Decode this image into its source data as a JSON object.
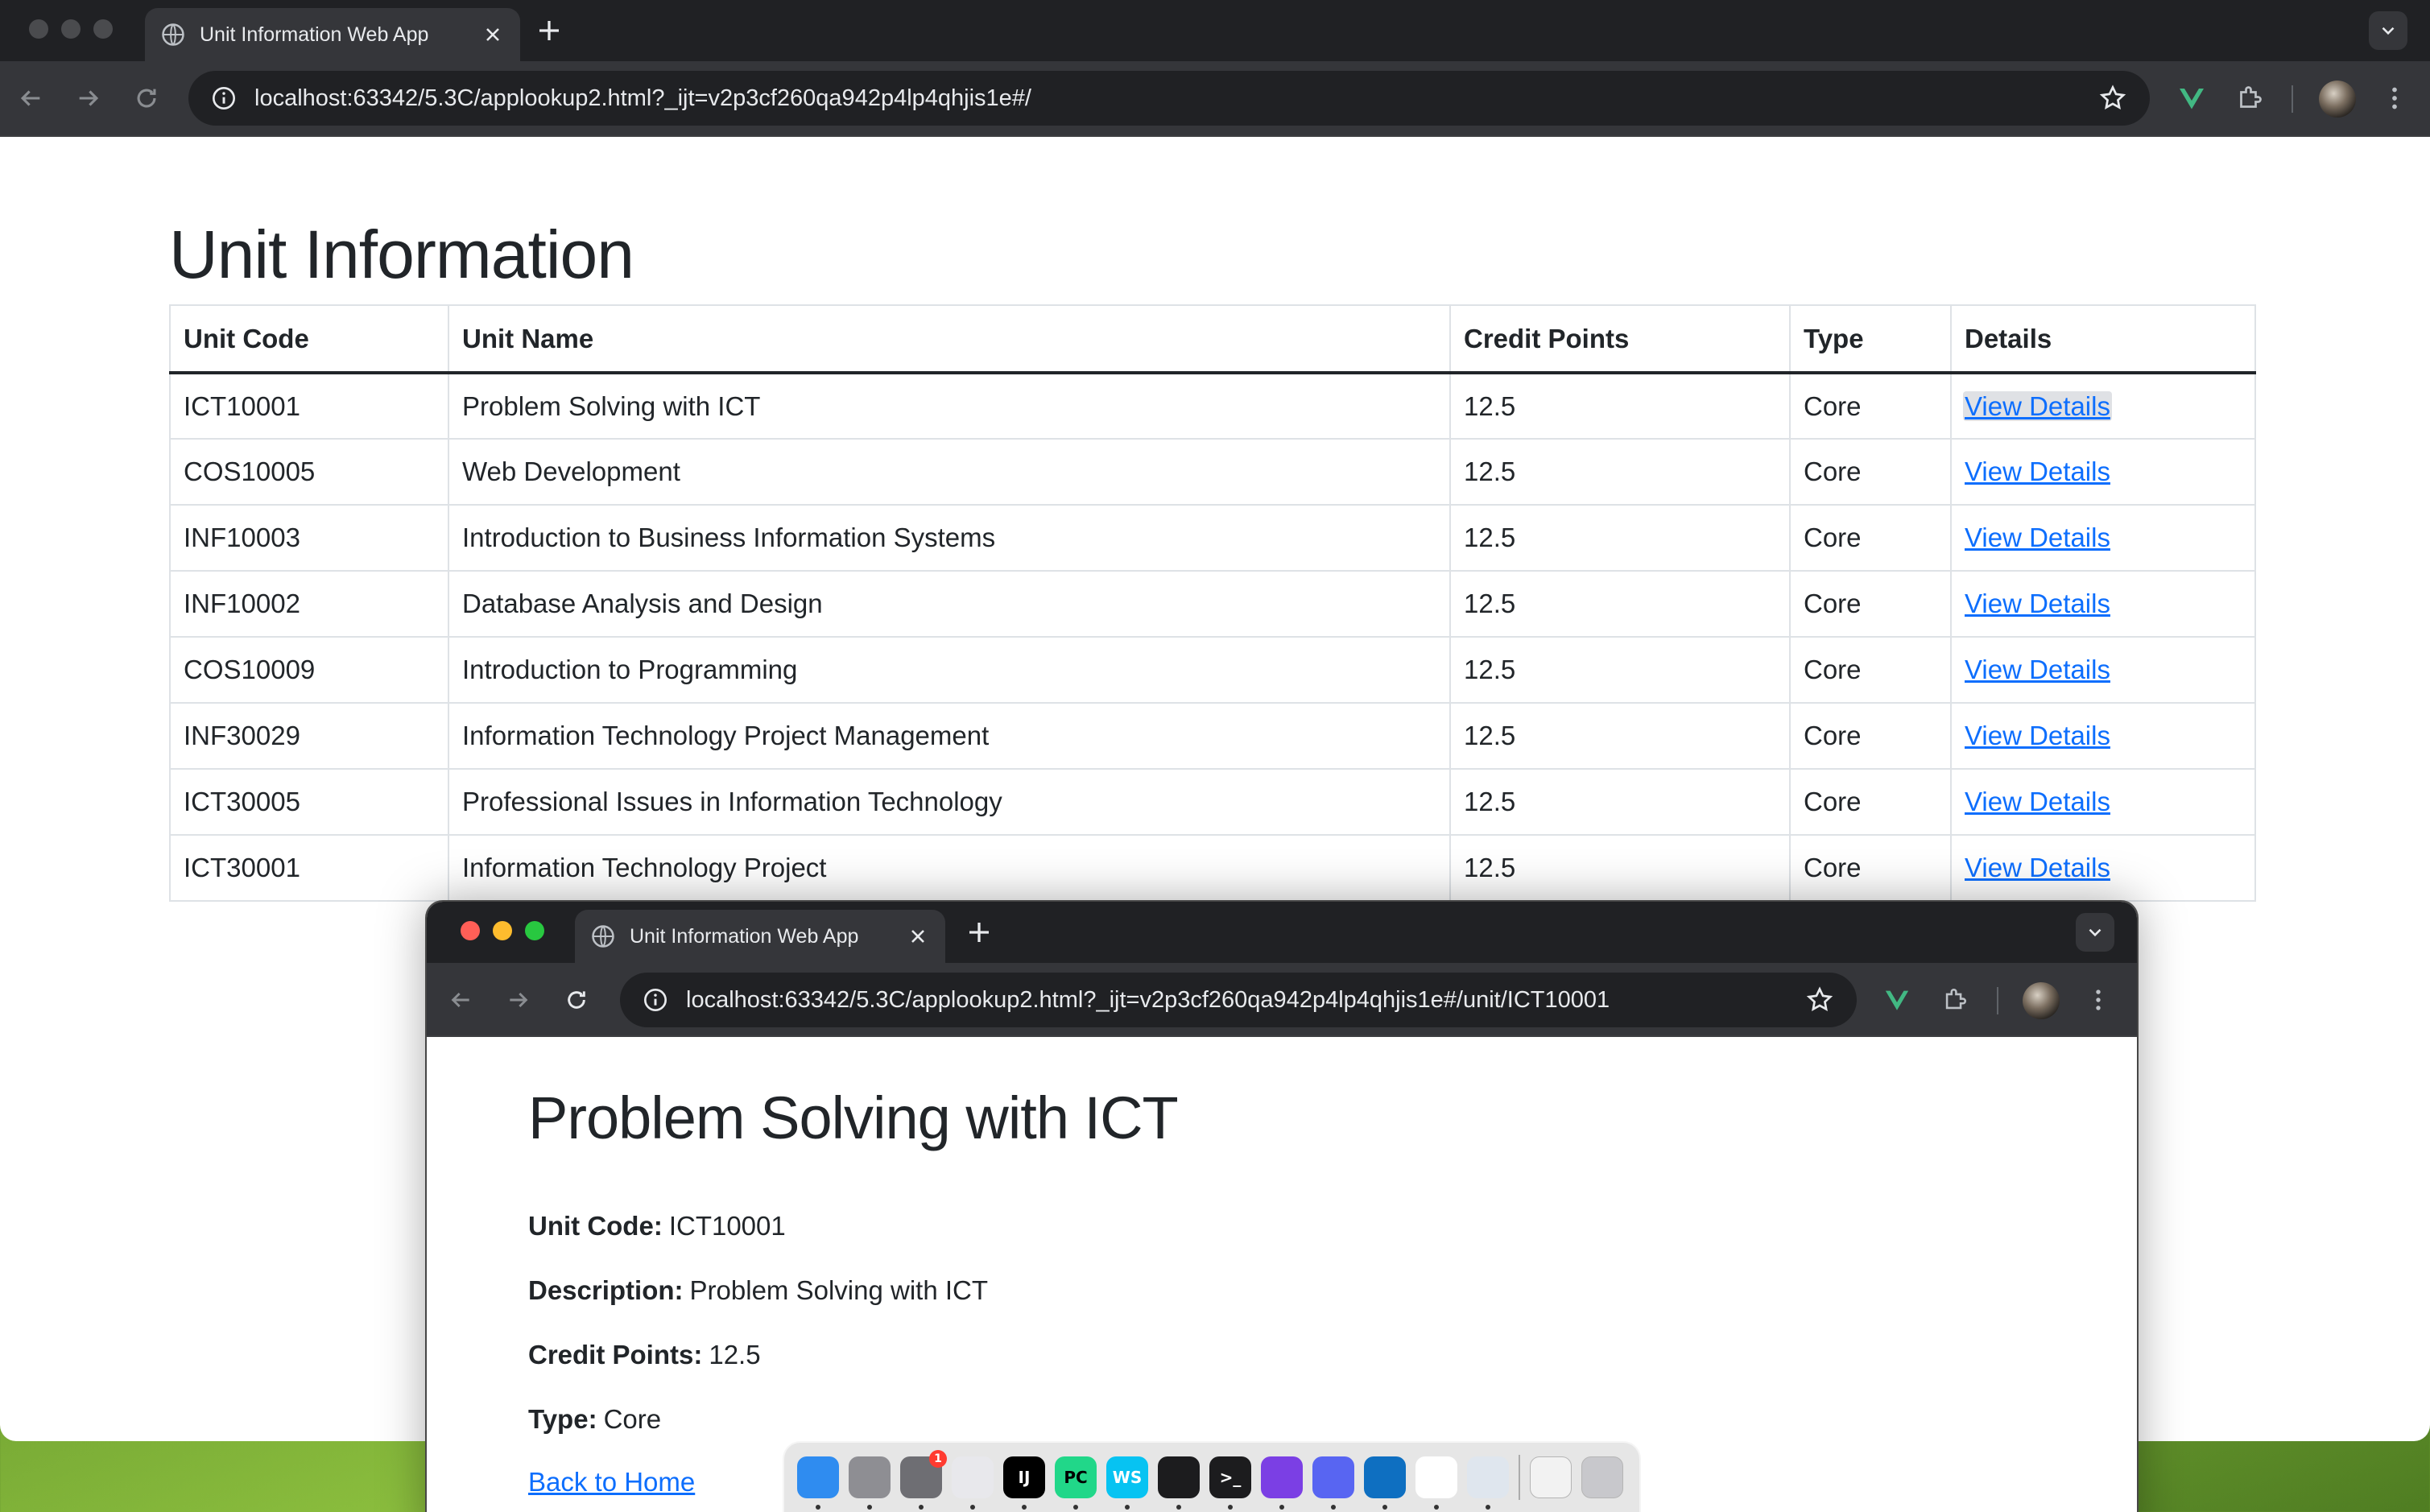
{
  "main_browser": {
    "tab_title": "Unit Information Web App",
    "url": "localhost:63342/5.3C/applookup2.html?_ijt=v2p3cf260qa942p4lp4qhjis1e#/"
  },
  "page": {
    "heading": "Unit Information",
    "columns": {
      "code": "Unit Code",
      "name": "Unit Name",
      "credit": "Credit Points",
      "type": "Type",
      "details": "Details"
    },
    "rows": [
      {
        "code": "ICT10001",
        "name": "Problem Solving with ICT",
        "credit": "12.5",
        "type": "Core",
        "details": "View Details"
      },
      {
        "code": "COS10005",
        "name": "Web Development",
        "credit": "12.5",
        "type": "Core",
        "details": "View Details"
      },
      {
        "code": "INF10003",
        "name": "Introduction to Business Information Systems",
        "credit": "12.5",
        "type": "Core",
        "details": "View Details"
      },
      {
        "code": "INF10002",
        "name": "Database Analysis and Design",
        "credit": "12.5",
        "type": "Core",
        "details": "View Details"
      },
      {
        "code": "COS10009",
        "name": "Introduction to Programming",
        "credit": "12.5",
        "type": "Core",
        "details": "View Details"
      },
      {
        "code": "INF30029",
        "name": "Information Technology Project Management",
        "credit": "12.5",
        "type": "Core",
        "details": "View Details"
      },
      {
        "code": "ICT30005",
        "name": "Professional Issues in Information Technology",
        "credit": "12.5",
        "type": "Core",
        "details": "View Details"
      },
      {
        "code": "ICT30001",
        "name": "Information Technology Project",
        "credit": "12.5",
        "type": "Core",
        "details": "View Details"
      }
    ]
  },
  "detail_browser": {
    "tab_title": "Unit Information Web App",
    "url": "localhost:63342/5.3C/applookup2.html?_ijt=v2p3cf260qa942p4lp4qhjis1e#/unit/ICT10001",
    "heading": "Problem Solving with ICT",
    "code_label": "Unit Code:",
    "code_value": "ICT10001",
    "description_label": "Description:",
    "description_value": "Problem Solving with ICT",
    "credit_label": "Credit Points:",
    "credit_value": "12.5",
    "type_label": "Type:",
    "type_value": "Core",
    "back_link": "Back to Home"
  },
  "dock": {
    "apps": [
      {
        "name": "finder",
        "color": "#2f8cf0",
        "glyph": ""
      },
      {
        "name": "launchpad",
        "color": "#8e8e93",
        "glyph": ""
      },
      {
        "name": "system-settings",
        "color": "#6e6e73",
        "glyph": "",
        "badge": "1"
      },
      {
        "name": "instruments",
        "color": "#e8e8ec",
        "glyph": ""
      },
      {
        "name": "intellij-idea",
        "color": "#000000",
        "glyph": "IJ"
      },
      {
        "name": "pycharm",
        "color": "#21d789",
        "glyph": "PC"
      },
      {
        "name": "webstorm",
        "color": "#07c3f2",
        "glyph": "WS"
      },
      {
        "name": "activity-monitor",
        "color": "#1c1c1e",
        "glyph": ""
      },
      {
        "name": "terminal",
        "color": "#1c1c1e",
        "glyph": ">_"
      },
      {
        "name": "github-desktop",
        "color": "#7b3fe4",
        "glyph": ""
      },
      {
        "name": "discord",
        "color": "#5865f2",
        "glyph": ""
      },
      {
        "name": "vscode",
        "color": "#0e6fc1",
        "glyph": ""
      },
      {
        "name": "chrome",
        "color": "#ffffff",
        "glyph": ""
      },
      {
        "name": "preview",
        "color": "#dfe6ee",
        "glyph": ""
      }
    ],
    "trailing": [
      {
        "name": "downloads-stack",
        "color": "#f2f2f2"
      },
      {
        "name": "trash",
        "color": "#c8c8cc"
      }
    ]
  },
  "colors": {
    "link": "#0d6efd",
    "chrome_dark": "#202124",
    "chrome_toolbar": "#35363a",
    "vue_green": "#42b883"
  }
}
